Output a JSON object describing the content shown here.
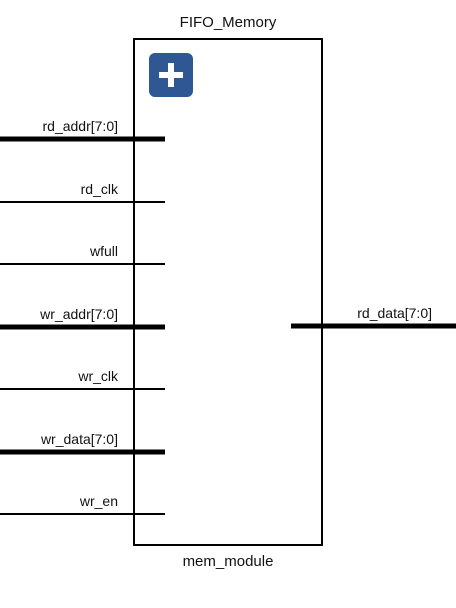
{
  "block": {
    "title": "FIFO_Memory",
    "module_name": "mem_module",
    "expand_icon": "plus-icon",
    "expand_icon_color": "#2e5794"
  },
  "ports": {
    "inputs": [
      {
        "name": "rd_addr[7:0]",
        "bus": true
      },
      {
        "name": "rd_clk",
        "bus": false
      },
      {
        "name": "wfull",
        "bus": false
      },
      {
        "name": "wr_addr[7:0]",
        "bus": true
      },
      {
        "name": "wr_clk",
        "bus": false
      },
      {
        "name": "wr_data[7:0]",
        "bus": true
      },
      {
        "name": "wr_en",
        "bus": false
      }
    ],
    "outputs": [
      {
        "name": "rd_data[7:0]",
        "bus": true
      }
    ]
  }
}
